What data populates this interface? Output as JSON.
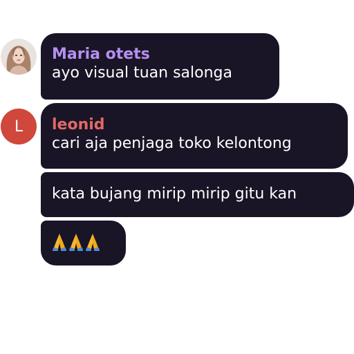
{
  "messages": [
    {
      "sender": "Maria otets",
      "text": "ayo visual tuan salonga",
      "name_color": "#b68ff0",
      "avatar": "photo-avatar"
    },
    {
      "sender": "leonid",
      "avatar_letter": "L",
      "avatar_color": "#d0473b",
      "text": "cari aja penjaga toko kelontong",
      "name_color": "#e26868"
    },
    {
      "text": "kata bujang mirip mirip gitu kan"
    },
    {
      "emoji": [
        "folded-hands-icon",
        "folded-hands-icon",
        "folded-hands-icon"
      ]
    }
  ],
  "colors": {
    "bubble_bg": "#191526",
    "text": "#ffffff"
  }
}
